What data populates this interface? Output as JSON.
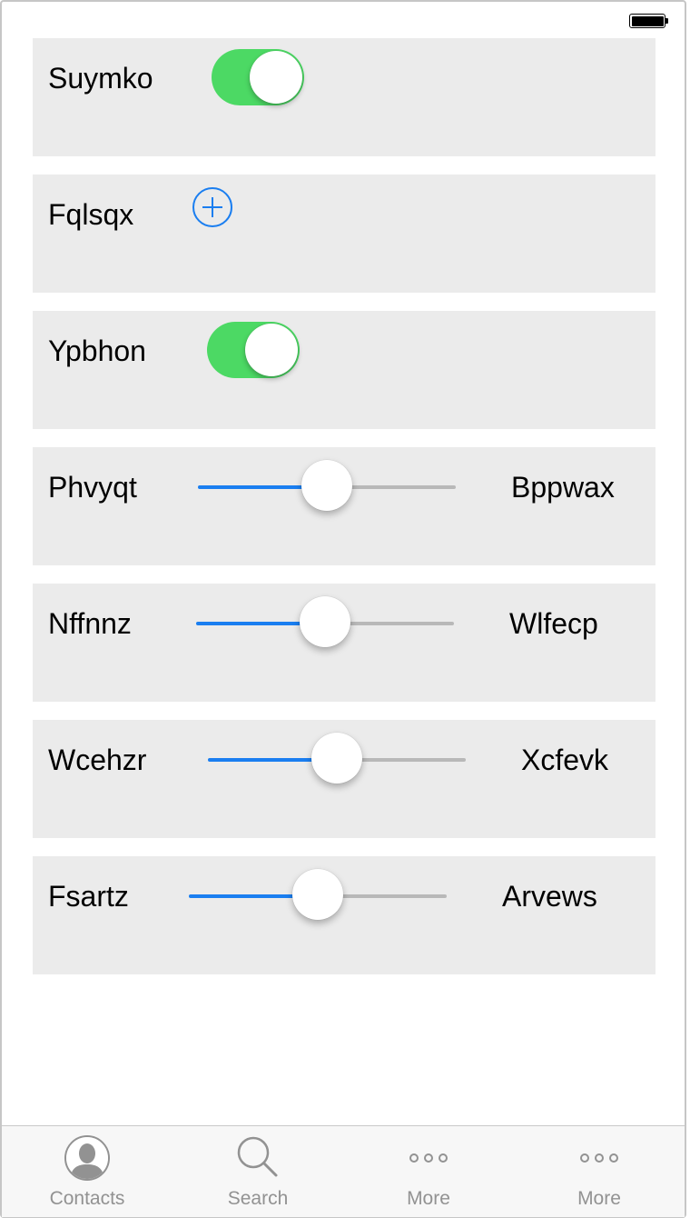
{
  "rows": [
    {
      "label": "Suymko",
      "control": "switch",
      "on": true
    },
    {
      "label": "Fqlsqx",
      "control": "add-button"
    },
    {
      "label": "Ypbhon",
      "control": "switch",
      "on": true
    },
    {
      "label": "Phvyqt",
      "control": "slider",
      "value": 0.5,
      "right_label": "Bppwax"
    },
    {
      "label": "Nffnnz",
      "control": "slider",
      "value": 0.5,
      "right_label": "Wlfecp"
    },
    {
      "label": "Wcehzr",
      "control": "slider",
      "value": 0.5,
      "right_label": "Xcfevk"
    },
    {
      "label": "Fsartz",
      "control": "slider",
      "value": 0.5,
      "right_label": "Arvews"
    }
  ],
  "tabbar": {
    "tabs": [
      {
        "label": "Contacts",
        "icon": "contacts-icon"
      },
      {
        "label": "Search",
        "icon": "search-icon"
      },
      {
        "label": "More",
        "icon": "more-icon"
      },
      {
        "label": "More",
        "icon": "more-icon"
      }
    ]
  },
  "colors": {
    "switch_on": "#4cd964",
    "slider_fill": "#1a7ef0",
    "row_bg": "#ebebeb",
    "tint": "#1a7ef0"
  }
}
